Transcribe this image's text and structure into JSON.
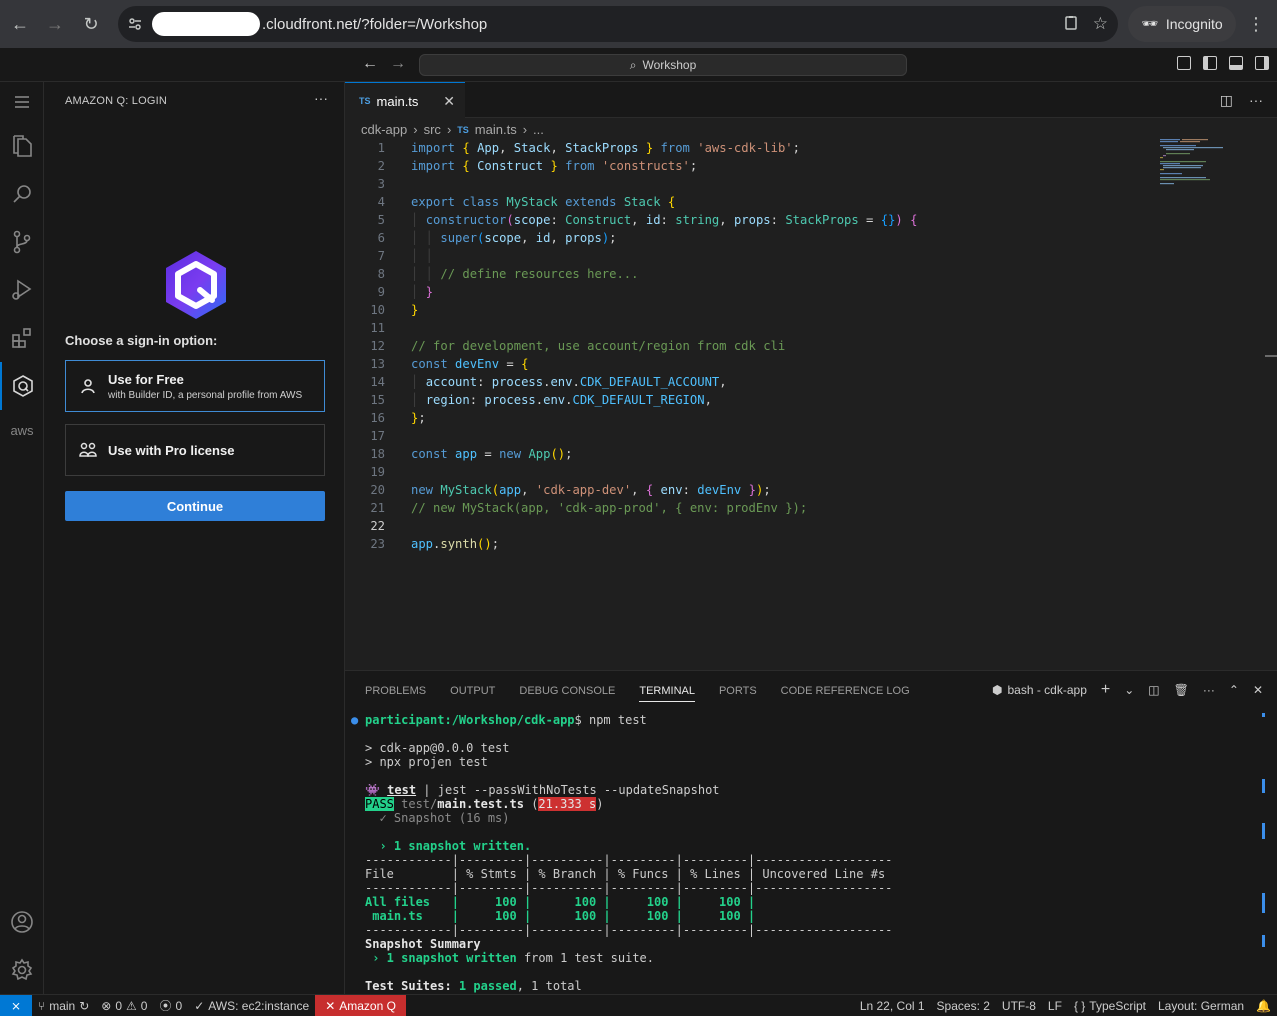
{
  "browser": {
    "url_domain": ".cloudfront.net/?folder=/Workshop",
    "profile_label": "Incognito"
  },
  "titlebar": {
    "command_center": "Workshop"
  },
  "sidebar": {
    "title": "AMAZON Q: LOGIN",
    "heading": "Choose a sign-in option:",
    "options": [
      {
        "title": "Use for Free",
        "subtitle": "with Builder ID, a personal profile from AWS"
      },
      {
        "title": "Use with Pro license",
        "subtitle": ""
      }
    ],
    "continue_label": "Continue",
    "aws_label": "aws"
  },
  "editor": {
    "tab_label": "main.ts",
    "tab_badge": "TS",
    "breadcrumb": [
      "cdk-app",
      "src",
      "main.ts",
      "..."
    ],
    "current_line": 22,
    "line_numbers": [
      "1",
      "2",
      "3",
      "4",
      "5",
      "6",
      "7",
      "8",
      "9",
      "10",
      "11",
      "12",
      "13",
      "14",
      "15",
      "16",
      "17",
      "18",
      "19",
      "20",
      "21",
      "22",
      "23"
    ]
  },
  "panel": {
    "tabs": [
      "PROBLEMS",
      "OUTPUT",
      "DEBUG CONSOLE",
      "TERMINAL",
      "PORTS",
      "CODE REFERENCE LOG"
    ],
    "active_tab": "TERMINAL",
    "terminal_name": "bash - cdk-app",
    "prompt_path": "participant:/Workshop/cdk-app",
    "command": "$ npm test",
    "out": {
      "l1": "> cdk-app@0.0.0 test",
      "l2": "> npx projen test",
      "task_prefix": "test",
      "task_cmd": " | jest --passWithNoTests --updateSnapshot",
      "pass": "PASS",
      "test_dir": " test/",
      "test_file": "main.test.ts",
      "time_open": " (",
      "time": "21.333 s",
      "time_close": ")",
      "snapshot_line": "  ✓ Snapshot (16 ms)",
      "written": "  › 1 snapshot written.",
      "divider": "------------|---------|----------|---------|---------|-------------------",
      "header": "File        | % Stmts | % Branch | % Funcs | % Lines | Uncovered Line #s ",
      "row1_name": "All files",
      "row1_rest": "   |     100 |      100 |     100 |     100 |                   ",
      "row2_name": " main.ts",
      "row2_rest": "    |     100 |      100 |     100 |     100 |                   ",
      "summary_title": "Snapshot Summary",
      "summary_written": " › 1 snapshot written",
      "summary_tail": " from 1 test suite.",
      "suites_label": "Test Suites: ",
      "suites_passed": "1 passed",
      "suites_tail": ", 1 total"
    }
  },
  "statusbar": {
    "branch": "main",
    "errors": "0",
    "warnings": "0",
    "ports": "0",
    "aws": "AWS: ec2:instance",
    "amazonq": "Amazon Q",
    "position": "Ln 22, Col 1",
    "spaces": "Spaces: 2",
    "encoding": "UTF-8",
    "eol": "LF",
    "language": "TypeScript",
    "layout": "Layout: German"
  },
  "colors": {
    "accent": "#0078d4",
    "amazonq_status": "#c72e2e",
    "continue_button": "#2f7fd8"
  }
}
